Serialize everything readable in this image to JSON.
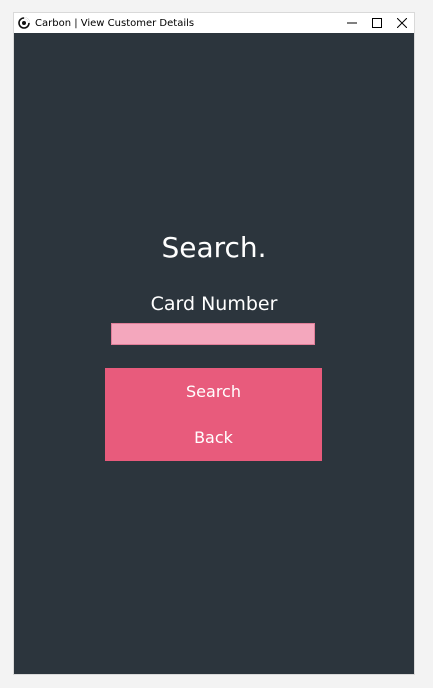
{
  "window": {
    "title": "Carbon | View Customer Details",
    "icon": "carbon-app-icon",
    "controls": [
      "minimize-icon",
      "maximize-icon",
      "close-icon"
    ]
  },
  "main": {
    "heading": "Search.",
    "field_label": "Card Number",
    "card_input_value": "",
    "card_input_placeholder": "",
    "search_label": "Search",
    "back_label": "Back"
  },
  "colors": {
    "background": "#2c353d",
    "input_fill": "#f4a7bd",
    "button_fill": "#e85b7c",
    "text": "#ffffff"
  }
}
